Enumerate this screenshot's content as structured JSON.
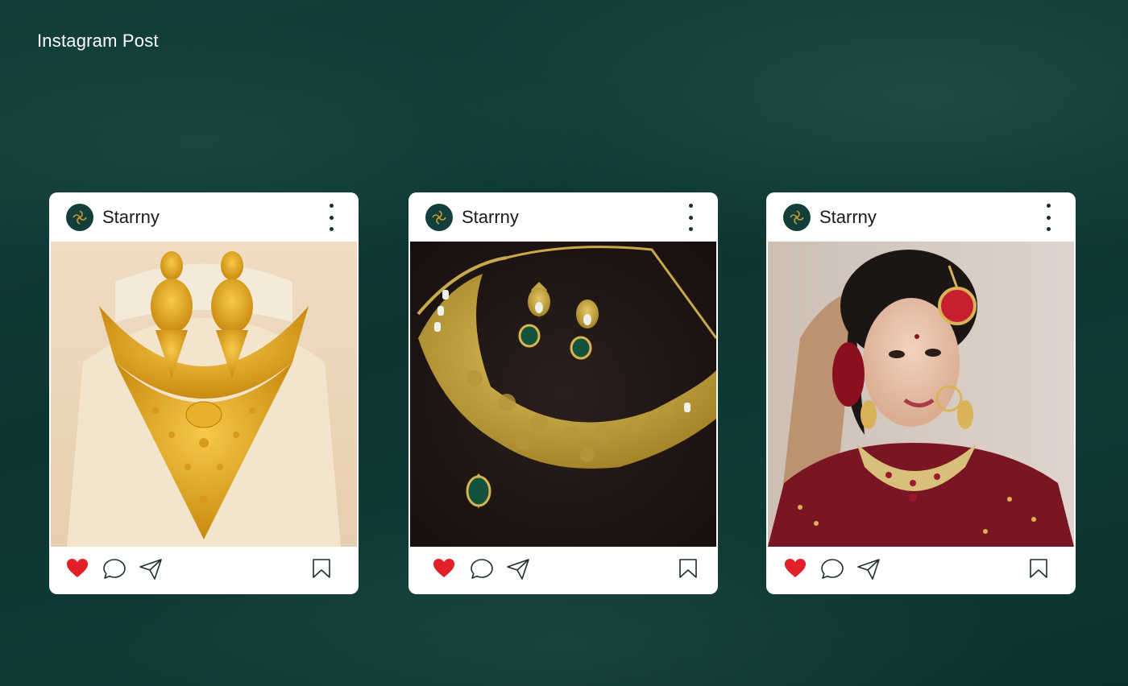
{
  "page": {
    "heading": "Instagram Post"
  },
  "colors": {
    "background": "#0f3b37",
    "card": "#ffffff",
    "like": "#e2202a",
    "avatar": "#123f3b",
    "gold": "#c99a2e"
  },
  "posts": [
    {
      "username": "Starrny",
      "photo": "gold necklace and earrings on cream bust",
      "liked": true
    },
    {
      "username": "Starrny",
      "photo": "gold floral necklace with green stone and earrings on dark cloth",
      "liked": true
    },
    {
      "username": "Starrny",
      "photo": "bride wearing kundan choker and maang tikka",
      "liked": true
    }
  ],
  "icons": [
    "starrny-logo-icon",
    "more-vertical-icon",
    "heart-icon",
    "comment-icon",
    "send-icon",
    "bookmark-icon"
  ]
}
